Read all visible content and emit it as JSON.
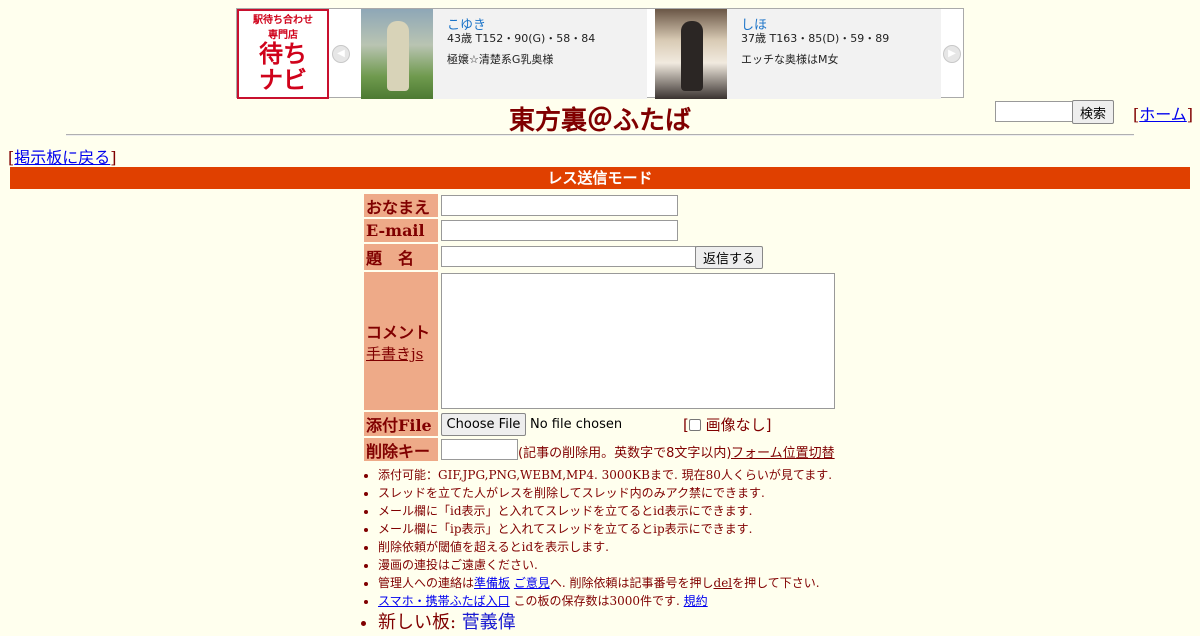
{
  "banner": {
    "logo": {
      "line1": "駅待ち合わせ",
      "line2": "専門店",
      "line3": "待ち",
      "line4": "ナビ"
    },
    "arrow_left": "◀",
    "arrow_right": "▶",
    "cards": [
      {
        "name": "こゆき",
        "spec": "43歳 T152・90(G)・58・84",
        "desc": "極嬢☆清楚系G乳奥様"
      },
      {
        "name": "しほ",
        "spec": "37歳 T163・85(D)・59・89",
        "desc": "エッチな奥様はM女"
      }
    ]
  },
  "header": {
    "title": "東方裏＠ふたば",
    "search_button": "検索",
    "home_open": "[",
    "home_label": "ホーム",
    "home_close": "]"
  },
  "nav": {
    "back_open": "[",
    "back_label": "掲示板に戻る",
    "back_close": "]"
  },
  "mode_bar": "レス送信モード",
  "form": {
    "name_label": "おなまえ",
    "email_label": "E-mail",
    "subject_label": "題　名",
    "submit_label": "返信する",
    "comment_label": "コメント",
    "handwrite_link": "手書きjs",
    "file_label": "添付File",
    "choose_file": "Choose File",
    "no_file": "No file chosen",
    "no_image_open": "[",
    "no_image_label": "画像なし",
    "no_image_close": "]",
    "delkey_label": "削除キー",
    "delkey_note": "(記事の削除用。英数字で8文字以内)",
    "form_toggle": "フォーム位置切替"
  },
  "notes": {
    "n1": "添付可能：GIF,JPG,PNG,WEBM,MP4. 3000KBまで. 現在80人くらいが見てます.",
    "n2": "スレッドを立てた人がレスを削除してスレッド内のみアク禁にできます.",
    "n3": "メール欄に「id表示」と入れてスレッドを立てるとid表示にできます.",
    "n4": "メール欄に「ip表示」と入れてスレッドを立てるとip表示にできます.",
    "n5": "削除依頼が閾値を超えるとidを表示します.",
    "n6": "漫画の連投はご遠慮ください.",
    "n7_pre": "管理人への連絡は",
    "n7_link1": "準備板",
    "n7_link2": "ご意見",
    "n7_mid": "へ. 削除依頼は記事番号を押し",
    "n7_del": "del",
    "n7_post": "を押して下さい.",
    "n8_link": "スマホ・携帯ふたば入口",
    "n8_mid": " この板の保存数は3000件です. ",
    "n8_rules": "規約",
    "n9_pre": "新しい板: ",
    "n9_link": "菅義偉"
  },
  "colors": {
    "accent_bar": "#e04000",
    "label_bg": "#eeaa88",
    "text": "#800000",
    "background": "#ffffee"
  }
}
